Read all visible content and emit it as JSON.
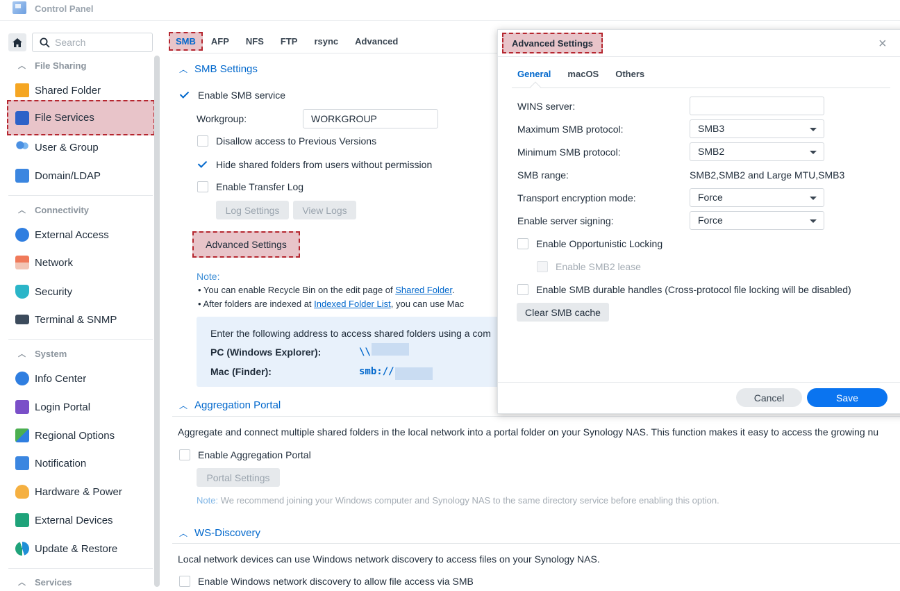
{
  "window": {
    "title": "Control Panel"
  },
  "sidebar": {
    "search_placeholder": "Search",
    "sections": [
      {
        "label": "File Sharing"
      },
      {
        "label": "Connectivity"
      },
      {
        "label": "System"
      },
      {
        "label": "Services"
      }
    ],
    "items": [
      {
        "label": "Shared Folder",
        "icon": "shared-folder-icon"
      },
      {
        "label": "File Services",
        "icon": "file-services-icon",
        "active": true
      },
      {
        "label": "User & Group",
        "icon": "user-group-icon"
      },
      {
        "label": "Domain/LDAP",
        "icon": "domain-ldap-icon"
      },
      {
        "label": "External Access",
        "icon": "external-access-icon"
      },
      {
        "label": "Network",
        "icon": "network-icon"
      },
      {
        "label": "Security",
        "icon": "security-icon"
      },
      {
        "label": "Terminal & SNMP",
        "icon": "terminal-icon"
      },
      {
        "label": "Info Center",
        "icon": "info-center-icon"
      },
      {
        "label": "Login Portal",
        "icon": "login-portal-icon"
      },
      {
        "label": "Regional Options",
        "icon": "regional-options-icon"
      },
      {
        "label": "Notification",
        "icon": "notification-icon"
      },
      {
        "label": "Hardware & Power",
        "icon": "hardware-power-icon"
      },
      {
        "label": "External Devices",
        "icon": "external-devices-icon"
      },
      {
        "label": "Update & Restore",
        "icon": "update-restore-icon"
      }
    ]
  },
  "tabs": [
    "SMB",
    "AFP",
    "NFS",
    "FTP",
    "rsync",
    "Advanced"
  ],
  "smb": {
    "section_title": "SMB Settings",
    "enable_label": "Enable SMB service",
    "workgroup_label": "Workgroup:",
    "workgroup_value": "WORKGROUP",
    "disallow_prev_label": "Disallow access to Previous Versions",
    "hide_shared_label": "Hide shared folders from users without permission",
    "transfer_log_label": "Enable Transfer Log",
    "log_settings_label": "Log Settings",
    "view_logs_label": "View Logs",
    "advanced_settings_label": "Advanced Settings",
    "note_title": "Note:",
    "note1_prefix": "• You can enable Recycle Bin on the edit page of ",
    "note1_link": "Shared Folder",
    "note1_suffix": ".",
    "note2_prefix": "• After folders are indexed at ",
    "note2_link": "Indexed Folder List",
    "note2_suffix": ", you can use Mac",
    "info_text": "Enter the following address to access shared folders using a com",
    "pc_label": "PC (Windows Explorer):",
    "pc_value": "\\\\",
    "mac_label": "Mac (Finder):",
    "mac_value": "smb://"
  },
  "aggregation": {
    "section_title": "Aggregation Portal",
    "description": "Aggregate and connect multiple shared folders in the local network into a portal folder on your Synology NAS. This function makes it easy to access the growing nu",
    "enable_label": "Enable Aggregation Portal",
    "portal_settings_label": "Portal Settings",
    "note_prefix": "Note:",
    "note_text": " We recommend joining your Windows computer and Synology NAS to the same directory service before enabling this option."
  },
  "ws_discovery": {
    "section_title": "WS-Discovery",
    "description": "Local network devices can use Windows network discovery to access files on your Synology NAS.",
    "enable_label": "Enable Windows network discovery to allow file access via SMB"
  },
  "dialog": {
    "title": "Advanced Settings",
    "close_glyph": "×",
    "tabs": [
      "General",
      "macOS",
      "Others"
    ],
    "wins_label": "WINS server:",
    "wins_value": "",
    "max_smb_label": "Maximum SMB protocol:",
    "max_smb_value": "SMB3",
    "min_smb_label": "Minimum SMB protocol:",
    "min_smb_value": "SMB2",
    "smb_range_label": "SMB range:",
    "smb_range_value": "SMB2,SMB2 and Large MTU,SMB3",
    "transport_label": "Transport encryption mode:",
    "transport_value": "Force",
    "signing_label": "Enable server signing:",
    "signing_value": "Force",
    "oplock_label": "Enable Opportunistic Locking",
    "smb2_lease_label": "Enable SMB2 lease",
    "durable_label": "Enable SMB durable handles (Cross-protocol file locking will be disabled)",
    "clear_cache_label": "Clear SMB cache",
    "cancel_label": "Cancel",
    "save_label": "Save"
  },
  "colors": {
    "accent": "#0067cc",
    "save_button": "#0a74f0",
    "highlight_fill": "#e8c4c9",
    "highlight_border": "#b5262f"
  }
}
